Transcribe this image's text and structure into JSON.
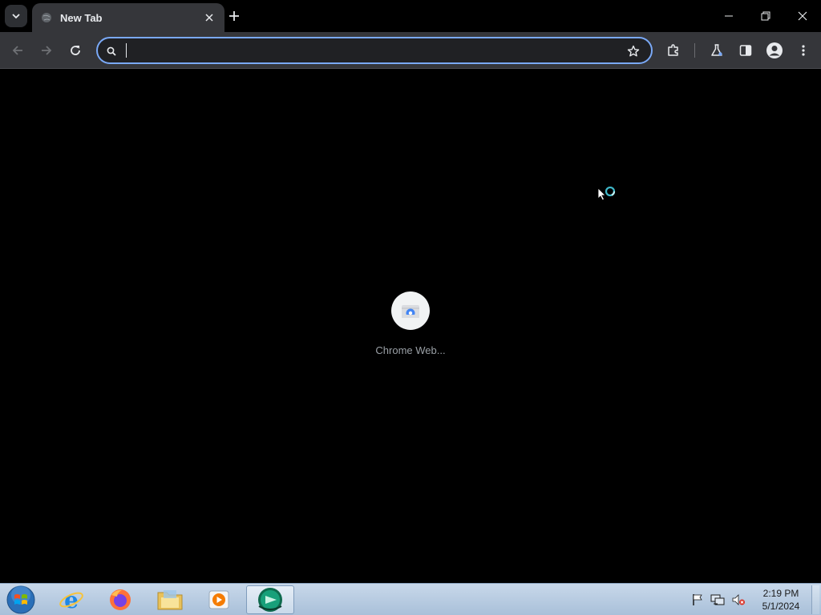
{
  "browser": {
    "tab": {
      "title": "New Tab"
    },
    "omnibox": {
      "value": "",
      "placeholder": ""
    }
  },
  "content": {
    "shortcut": {
      "label": "Chrome Web..."
    }
  },
  "taskbar": {
    "apps": [
      "start-orb",
      "internet-explorer",
      "firefox",
      "file-explorer",
      "media-player",
      "active-app"
    ],
    "clock": {
      "time": "2:19 PM",
      "date": "5/1/2024"
    }
  },
  "colors": {
    "accent": "#7aa9f7",
    "toolbar": "#35363a",
    "background": "#000000"
  }
}
